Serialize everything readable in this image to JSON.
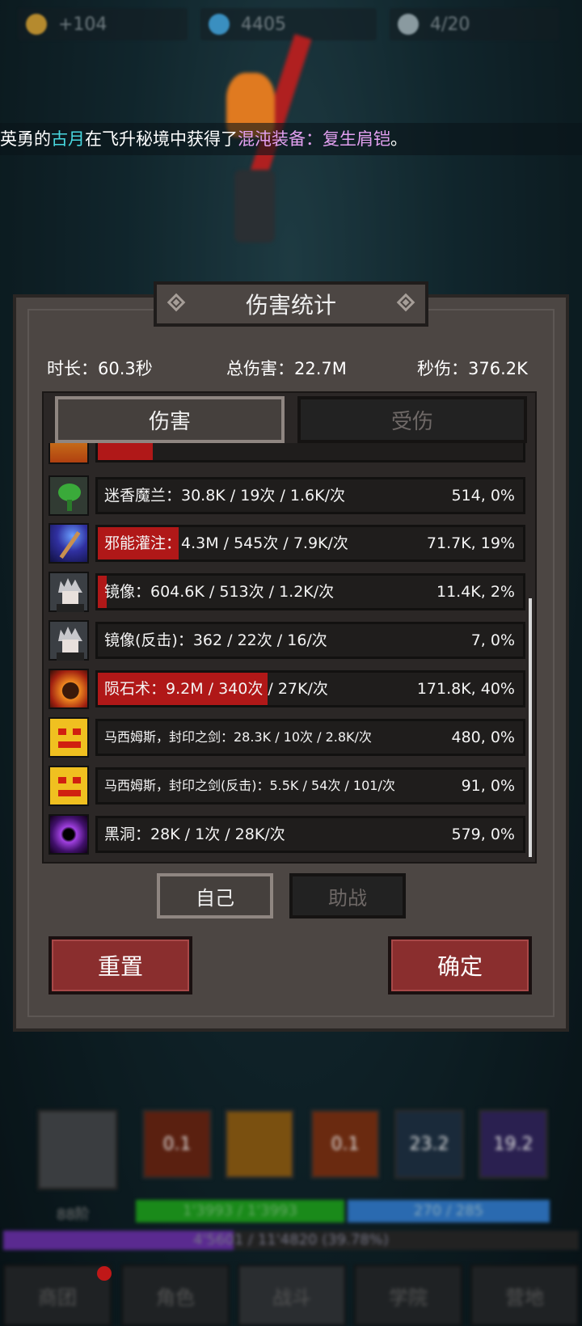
{
  "resources": {
    "gold": "+104",
    "gems": "4405",
    "tickets": "4/20"
  },
  "announcement": {
    "prefix": "英勇的",
    "player": "古月",
    "middle": "在飞升秘境中获得了",
    "item": "混沌装备：复生肩铠",
    "suffix": "。"
  },
  "panel": {
    "title": "伤害统计",
    "duration": "时长：60.3秒",
    "total_damage": "总伤害：22.7M",
    "dps": "秒伤：376.2K",
    "tabs": {
      "damage": "伤害",
      "taken": "受伤"
    },
    "sub_tabs": {
      "self": "自己",
      "assist": "助战"
    },
    "buttons": {
      "reset": "重置",
      "confirm": "确定"
    }
  },
  "rows": [
    {
      "icon": "partial-top-icon",
      "label": "",
      "value": "",
      "share": 0.13
    },
    {
      "icon": "plant-icon",
      "label": "迷香魔兰：30.8K / 19次 / 1.6K/次",
      "value": "514, 0%",
      "share": 0.0
    },
    {
      "icon": "magic-staff-icon",
      "label": "邪能灌注：4.3M / 545次 / 7.9K/次",
      "value": "71.7K, 19%",
      "share": 0.19
    },
    {
      "icon": "mirror-image-icon",
      "label": "镜像：604.6K / 513次 / 1.2K/次",
      "value": "11.4K, 2%",
      "share": 0.02
    },
    {
      "icon": "mirror-image-icon",
      "label": "镜像(反击)：362 / 22次 / 16/次",
      "value": "7, 0%",
      "share": 0.0
    },
    {
      "icon": "meteor-icon",
      "label": "陨石术：9.2M / 340次 / 27K/次",
      "value": "171.8K, 40%",
      "share": 0.4
    },
    {
      "icon": "sealed-sword-mask-icon",
      "label": "马西姆斯，封印之剑：28.3K / 10次 / 2.8K/次",
      "value": "480, 0%",
      "share": 0.0
    },
    {
      "icon": "sealed-sword-mask-icon",
      "label": "马西姆斯，封印之剑(反击)：5.5K / 54次 / 101/次",
      "value": "91, 0%",
      "share": 0.0
    },
    {
      "icon": "black-hole-icon",
      "label": "黑洞：28K / 1次 / 28K/次",
      "value": "579, 0%",
      "share": 0.0
    }
  ],
  "hud": {
    "level": "88阶",
    "skills": [
      "0.1",
      "",
      "0.1",
      "23.2",
      "19.2"
    ],
    "hp": "1'3993 / 1'3993",
    "mp": "270 / 285",
    "xp": "4'5601 / 11'4820 (39.78%)",
    "xp_share": 0.4
  },
  "nav": [
    "商团",
    "角色",
    "战斗",
    "学院",
    "营地"
  ]
}
